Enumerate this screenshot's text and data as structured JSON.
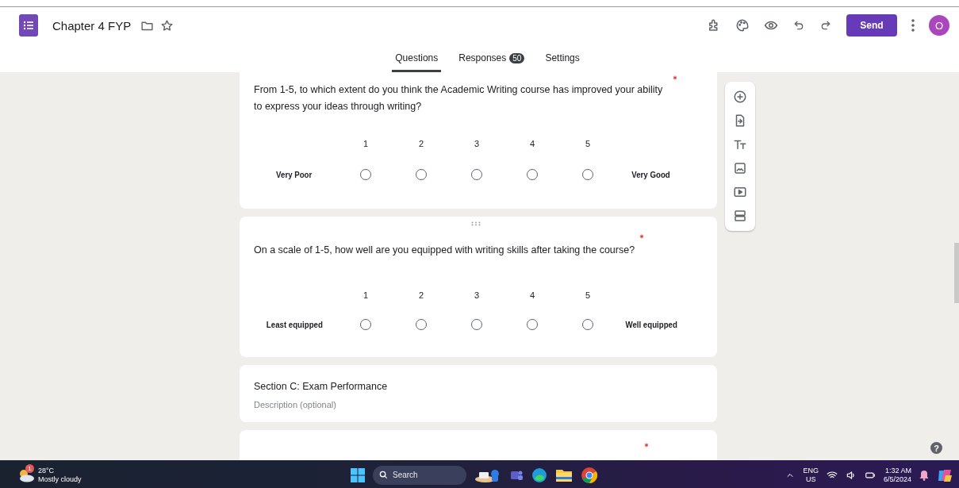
{
  "header": {
    "title": "Chapter 4 FYP",
    "send_button": "Send",
    "avatar": "O"
  },
  "tabs": [
    {
      "label": "Questions",
      "selected": true
    },
    {
      "label": "Responses",
      "selected": false,
      "badge": "50"
    },
    {
      "label": "Settings",
      "selected": false
    }
  ],
  "cards": [
    {
      "kind": "scale",
      "text": "From 1-5, to which extent do you think the Academic Writing course has improved your ability to express your ideas through writing?",
      "required": true,
      "scale": [
        "1",
        "2",
        "3",
        "4",
        "5"
      ],
      "options": [
        {
          "selected": false
        },
        {
          "selected": false
        },
        {
          "selected": false
        },
        {
          "selected": false
        },
        {
          "selected": false
        }
      ],
      "low_label": "Very Poor",
      "high_label": "Very Good"
    },
    {
      "kind": "scale",
      "text": "On a scale of 1-5, how well are you equipped with writing skills after taking the course?",
      "required": true,
      "scale": [
        "1",
        "2",
        "3",
        "4",
        "5"
      ],
      "options": [
        {
          "selected": false
        },
        {
          "selected": false
        },
        {
          "selected": false
        },
        {
          "selected": false
        },
        {
          "selected": false
        }
      ],
      "low_label": "Least equipped",
      "high_label": "Well equipped"
    },
    {
      "kind": "section",
      "title": "Section C: Exam Performance",
      "placeholder": "Description (optional)"
    },
    {
      "kind": "blank",
      "required": true
    }
  ],
  "help": "?",
  "taskbar": {
    "weather_badge": "1",
    "temperature": "28°C",
    "weather": "Mostly cloudy",
    "search_placeholder": "Search",
    "language": "ENG",
    "region": "US",
    "time": "1:32 AM",
    "date": "6/5/2024"
  }
}
